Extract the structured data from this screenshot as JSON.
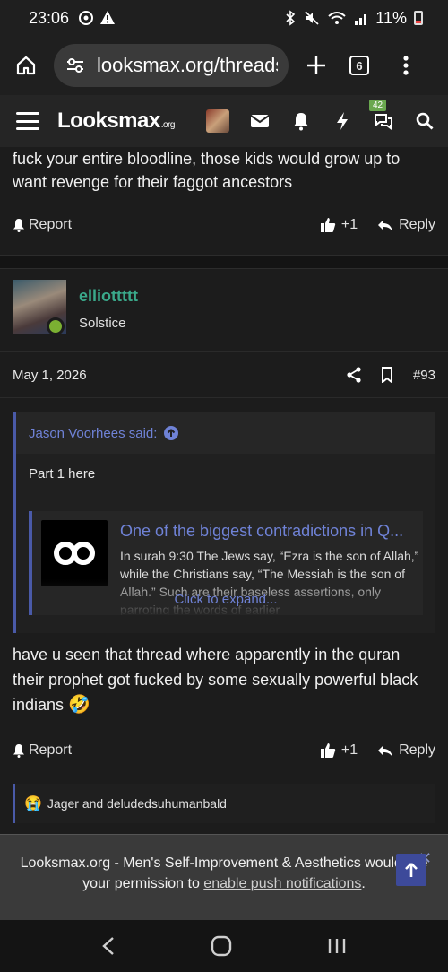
{
  "status_bar": {
    "time": "23:06",
    "battery": "11%"
  },
  "browser": {
    "url": "looksmax.org/threads/",
    "tab_count": "6"
  },
  "site": {
    "logo": "Looksmax",
    "logo_suffix": ".org",
    "alerts_badge": "42"
  },
  "previous_post": {
    "text": "fuck your entire bloodline, those kids would grow up to want revenge for their faggot ancestors",
    "report_label": "Report",
    "like_count": "+1",
    "reply_label": "Reply"
  },
  "post": {
    "username": "elliottttt",
    "user_title": "Solstice",
    "date": "May 1, 2026",
    "number": "#93",
    "quote": {
      "author": "Jason Voorhees said:",
      "text": "Part 1 here",
      "embed_title": "One of the biggest contradictions in Q...",
      "embed_desc": "In surah 9:30 The Jews say, “Ezra is the son of Allah,” while the Christians say, “The Messiah is the son of Allah.” Such are their baseless assertions, only parroting the words of earlier",
      "expand_label": "Click to expand..."
    },
    "text": "have u seen that thread where apparently in the quran their prophet got fucked by some sexually powerful black indians",
    "emoji": "🤣",
    "report_label": "Report",
    "like_count": "+1",
    "reply_label": "Reply",
    "reactions": "Jager and deludedsuhumanbald"
  },
  "notification": {
    "text_before": "Looksmax.org - Men's Self-Improvement & Aesthetics would like your permission to ",
    "link": "enable push notifications",
    "text_after": "."
  },
  "colors": {
    "accent": "#6f82d6",
    "username": "#3aa88a",
    "online": "#7bb032"
  }
}
